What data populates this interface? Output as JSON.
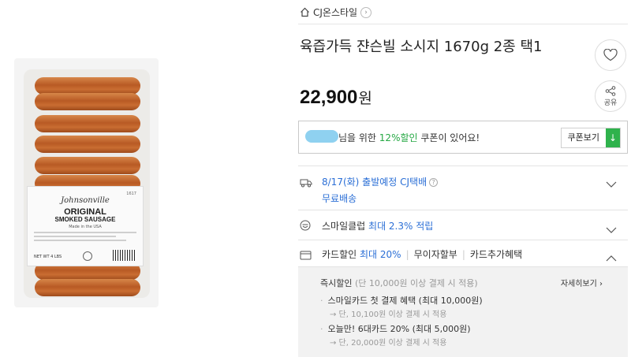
{
  "product_image": {
    "brand": "Johnsonville",
    "sku": "1617",
    "title_line1": "ORIGINAL",
    "title_line2": "SMOKED SAUSAGE",
    "origin": "Made in the USA",
    "net_wt": "NET WT 4 LBS",
    "icon": "product-photo"
  },
  "store": {
    "name": "CJ온스타일",
    "home_icon": "home-icon",
    "chevron": "›"
  },
  "product": {
    "title": "육즙가득 쟌슨빌 소시지 1670g 2종 택1",
    "price": "22,900",
    "price_unit": "원"
  },
  "actions": {
    "wishlist_icon": "heart-icon",
    "share_label": "공유"
  },
  "coupon": {
    "text_before": "님을 위한 ",
    "percent": "12%할인",
    "text_after": " 쿠폰이 있어요!",
    "button": "쿠폰보기",
    "download_glyph": "↓"
  },
  "delivery": {
    "date": "8/17(화) 출발예정",
    "courier": "CJ택배",
    "info_glyph": "?",
    "free": "무료배송"
  },
  "smile": {
    "label": "스마일클럽",
    "highlight": "최대 2.3% 적립"
  },
  "card": {
    "label": "카드할인",
    "highlight": "최대 20%",
    "installment": "무이자할부",
    "extra": "카드추가혜택"
  },
  "card_detail": {
    "heading": "즉시할인",
    "heading_note": "(단 10,000원 이상 결제 시 적용)",
    "more": "자세히보기 ›",
    "items": [
      {
        "title": "스마일카드 첫 결제 혜택 (최대 10,000원)",
        "sub": "→ 단, 10,100원 이상 결제 시 적용"
      },
      {
        "title": "오늘만! 6대카드 20% (최대 5,000원)",
        "sub": "→ 단, 20,000원 이상 결제 시 적용"
      }
    ]
  },
  "colors": {
    "accent_green": "#26a844",
    "accent_blue": "#2b6fd6",
    "coupon_button": "#2fb24c"
  }
}
